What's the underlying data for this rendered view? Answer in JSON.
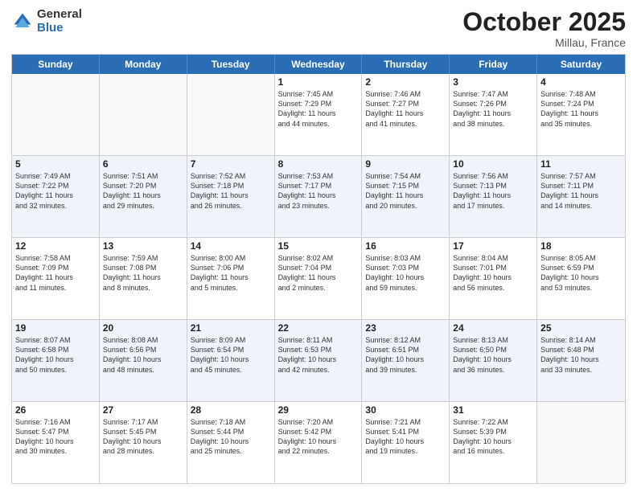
{
  "logo": {
    "general": "General",
    "blue": "Blue"
  },
  "title": {
    "month": "October 2025",
    "location": "Millau, France"
  },
  "weekdays": [
    "Sunday",
    "Monday",
    "Tuesday",
    "Wednesday",
    "Thursday",
    "Friday",
    "Saturday"
  ],
  "rows": [
    {
      "alt": false,
      "cells": [
        {
          "day": "",
          "text": ""
        },
        {
          "day": "",
          "text": ""
        },
        {
          "day": "",
          "text": ""
        },
        {
          "day": "1",
          "text": "Sunrise: 7:45 AM\nSunset: 7:29 PM\nDaylight: 11 hours\nand 44 minutes."
        },
        {
          "day": "2",
          "text": "Sunrise: 7:46 AM\nSunset: 7:27 PM\nDaylight: 11 hours\nand 41 minutes."
        },
        {
          "day": "3",
          "text": "Sunrise: 7:47 AM\nSunset: 7:26 PM\nDaylight: 11 hours\nand 38 minutes."
        },
        {
          "day": "4",
          "text": "Sunrise: 7:48 AM\nSunset: 7:24 PM\nDaylight: 11 hours\nand 35 minutes."
        }
      ]
    },
    {
      "alt": true,
      "cells": [
        {
          "day": "5",
          "text": "Sunrise: 7:49 AM\nSunset: 7:22 PM\nDaylight: 11 hours\nand 32 minutes."
        },
        {
          "day": "6",
          "text": "Sunrise: 7:51 AM\nSunset: 7:20 PM\nDaylight: 11 hours\nand 29 minutes."
        },
        {
          "day": "7",
          "text": "Sunrise: 7:52 AM\nSunset: 7:18 PM\nDaylight: 11 hours\nand 26 minutes."
        },
        {
          "day": "8",
          "text": "Sunrise: 7:53 AM\nSunset: 7:17 PM\nDaylight: 11 hours\nand 23 minutes."
        },
        {
          "day": "9",
          "text": "Sunrise: 7:54 AM\nSunset: 7:15 PM\nDaylight: 11 hours\nand 20 minutes."
        },
        {
          "day": "10",
          "text": "Sunrise: 7:56 AM\nSunset: 7:13 PM\nDaylight: 11 hours\nand 17 minutes."
        },
        {
          "day": "11",
          "text": "Sunrise: 7:57 AM\nSunset: 7:11 PM\nDaylight: 11 hours\nand 14 minutes."
        }
      ]
    },
    {
      "alt": false,
      "cells": [
        {
          "day": "12",
          "text": "Sunrise: 7:58 AM\nSunset: 7:09 PM\nDaylight: 11 hours\nand 11 minutes."
        },
        {
          "day": "13",
          "text": "Sunrise: 7:59 AM\nSunset: 7:08 PM\nDaylight: 11 hours\nand 8 minutes."
        },
        {
          "day": "14",
          "text": "Sunrise: 8:00 AM\nSunset: 7:06 PM\nDaylight: 11 hours\nand 5 minutes."
        },
        {
          "day": "15",
          "text": "Sunrise: 8:02 AM\nSunset: 7:04 PM\nDaylight: 11 hours\nand 2 minutes."
        },
        {
          "day": "16",
          "text": "Sunrise: 8:03 AM\nSunset: 7:03 PM\nDaylight: 10 hours\nand 59 minutes."
        },
        {
          "day": "17",
          "text": "Sunrise: 8:04 AM\nSunset: 7:01 PM\nDaylight: 10 hours\nand 56 minutes."
        },
        {
          "day": "18",
          "text": "Sunrise: 8:05 AM\nSunset: 6:59 PM\nDaylight: 10 hours\nand 53 minutes."
        }
      ]
    },
    {
      "alt": true,
      "cells": [
        {
          "day": "19",
          "text": "Sunrise: 8:07 AM\nSunset: 6:58 PM\nDaylight: 10 hours\nand 50 minutes."
        },
        {
          "day": "20",
          "text": "Sunrise: 8:08 AM\nSunset: 6:56 PM\nDaylight: 10 hours\nand 48 minutes."
        },
        {
          "day": "21",
          "text": "Sunrise: 8:09 AM\nSunset: 6:54 PM\nDaylight: 10 hours\nand 45 minutes."
        },
        {
          "day": "22",
          "text": "Sunrise: 8:11 AM\nSunset: 6:53 PM\nDaylight: 10 hours\nand 42 minutes."
        },
        {
          "day": "23",
          "text": "Sunrise: 8:12 AM\nSunset: 6:51 PM\nDaylight: 10 hours\nand 39 minutes."
        },
        {
          "day": "24",
          "text": "Sunrise: 8:13 AM\nSunset: 6:50 PM\nDaylight: 10 hours\nand 36 minutes."
        },
        {
          "day": "25",
          "text": "Sunrise: 8:14 AM\nSunset: 6:48 PM\nDaylight: 10 hours\nand 33 minutes."
        }
      ]
    },
    {
      "alt": false,
      "cells": [
        {
          "day": "26",
          "text": "Sunrise: 7:16 AM\nSunset: 5:47 PM\nDaylight: 10 hours\nand 30 minutes."
        },
        {
          "day": "27",
          "text": "Sunrise: 7:17 AM\nSunset: 5:45 PM\nDaylight: 10 hours\nand 28 minutes."
        },
        {
          "day": "28",
          "text": "Sunrise: 7:18 AM\nSunset: 5:44 PM\nDaylight: 10 hours\nand 25 minutes."
        },
        {
          "day": "29",
          "text": "Sunrise: 7:20 AM\nSunset: 5:42 PM\nDaylight: 10 hours\nand 22 minutes."
        },
        {
          "day": "30",
          "text": "Sunrise: 7:21 AM\nSunset: 5:41 PM\nDaylight: 10 hours\nand 19 minutes."
        },
        {
          "day": "31",
          "text": "Sunrise: 7:22 AM\nSunset: 5:39 PM\nDaylight: 10 hours\nand 16 minutes."
        },
        {
          "day": "",
          "text": ""
        }
      ]
    }
  ]
}
